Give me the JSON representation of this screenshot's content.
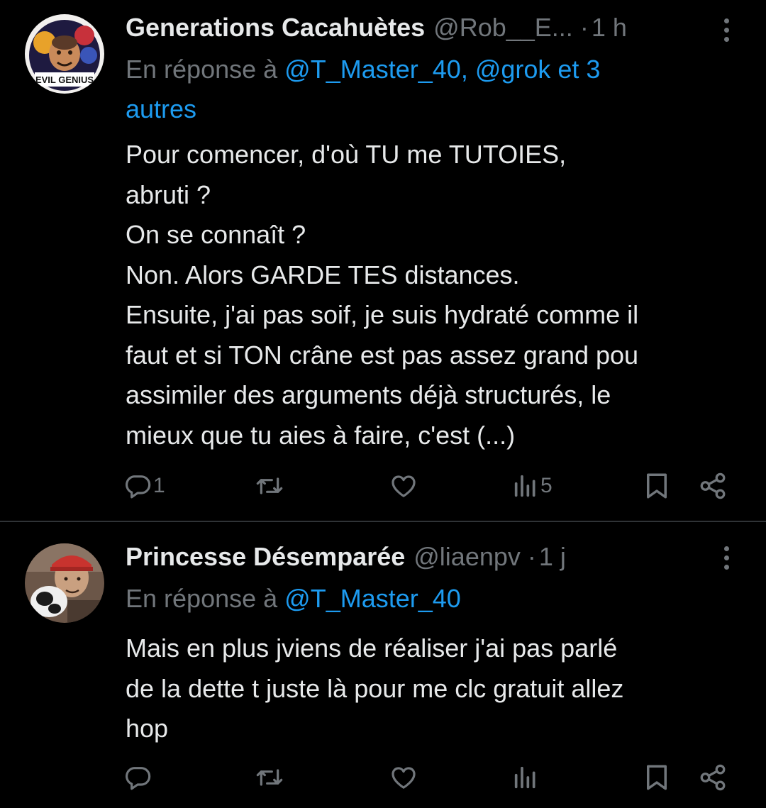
{
  "colors": {
    "background": "#000000",
    "text_primary": "#e7e9ea",
    "text_secondary": "#71767b",
    "link": "#1d9bf0",
    "divider": "#2f3336"
  },
  "tweets": [
    {
      "display_name": "Generations Cacahuètes",
      "handle": "@Rob__E...",
      "separator": "·",
      "time": "1 h",
      "reply_prefix": "En réponse à",
      "reply_mentions": "@T_Master_40, @grok et 3",
      "reply_mentions_more": "autres",
      "avatar_text": "EVIL GENIUS",
      "body_lines": [
        "Pour comencer, d'où TU me TUTOIES,",
        "abruti ?",
        "On se connaît ?",
        "Non. Alors GARDE TES distances.",
        "Ensuite, j'ai pas soif, je suis hydraté comme il",
        "faut et si TON crâne est pas assez grand pou",
        "assimiler des arguments déjà structurés, le",
        "mieux que tu aies à faire, c'est (...)"
      ],
      "actions": {
        "reply_count": "1",
        "views_count": "5"
      },
      "icons": {
        "reply": "reply-bubble-icon",
        "retweet": "retweet-icon",
        "like": "heart-icon",
        "views": "views-chart-icon",
        "bookmark": "bookmark-icon",
        "share": "share-icon",
        "more": "more-vertical-icon"
      }
    },
    {
      "display_name": "Princesse Désemparée",
      "handle": "@liaenpv",
      "separator": "·",
      "time": "1 j",
      "reply_prefix": "En réponse à",
      "reply_mentions": "@T_Master_40",
      "body_lines": [
        "Mais en plus jviens de réaliser j'ai pas parlé",
        "de la dette t juste là pour me clc gratuit allez",
        "hop"
      ],
      "actions": {
        "reply_count": "",
        "views_count": ""
      },
      "icons": {
        "reply": "reply-bubble-icon",
        "retweet": "retweet-icon",
        "like": "heart-icon",
        "views": "views-chart-icon",
        "bookmark": "bookmark-icon",
        "share": "share-icon",
        "more": "more-vertical-icon"
      }
    }
  ]
}
